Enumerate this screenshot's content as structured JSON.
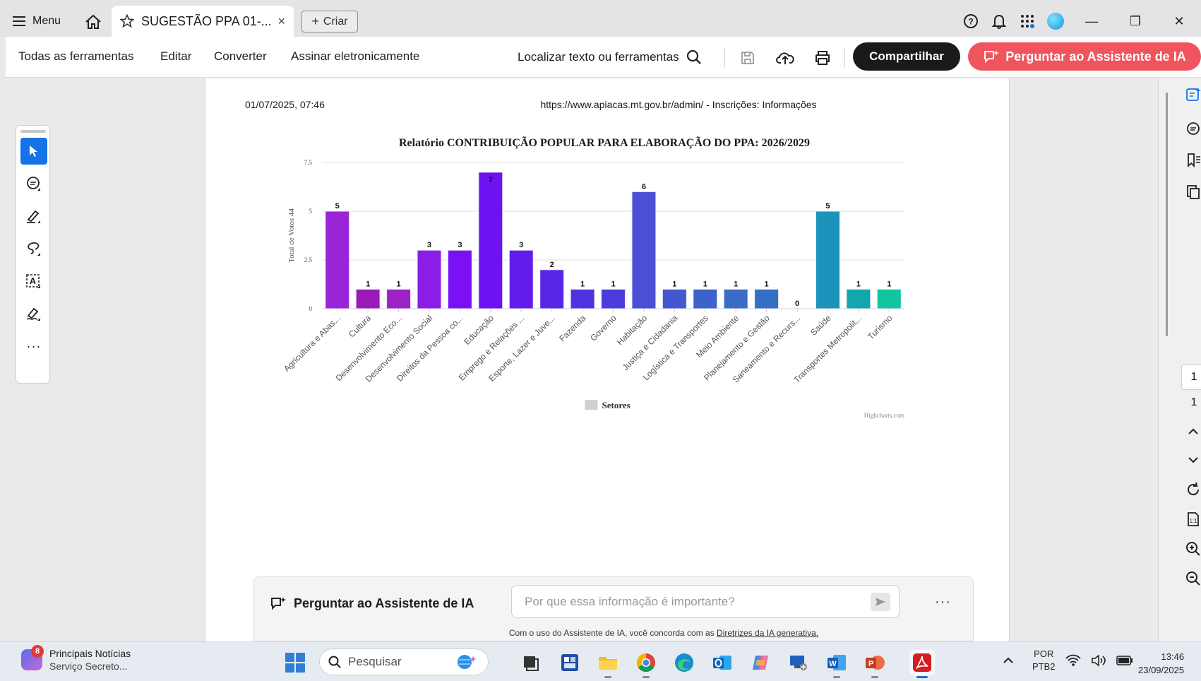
{
  "titlebar": {
    "menu_label": "Menu",
    "tab_title": "SUGESTÃO PPA 01-...",
    "tab_close": "×",
    "create_label": "Criar",
    "window_minimize": "—",
    "window_restore": "❐",
    "window_close": "✕"
  },
  "toolbar": {
    "menus": [
      "Todas as ferramentas",
      "Editar",
      "Converter",
      "Assinar eletronicamente"
    ],
    "find_label": "Localizar texto ou ferramentas",
    "share_label": "Compartilhar",
    "ai_label": "Perguntar ao Assistente de IA"
  },
  "document": {
    "date": "01/07/2025, 07:46",
    "url": "https://www.apiacas.mt.gov.br/admin/ - Inscrições: Informações"
  },
  "chart_data": {
    "type": "bar",
    "title": "Relatório CONTRIBUIÇÃO POPULAR PARA ELABORAÇÃO DO PPA: 2026/2029",
    "ylabel": "Total de Votos 44",
    "xlabel": "",
    "ylim": [
      0,
      7.5
    ],
    "yticks": [
      "0",
      "2.5",
      "5",
      "7.5"
    ],
    "legend": "Setores",
    "legend_position": "bottom-center",
    "grid": true,
    "credits": "Highcharts.com",
    "categories": [
      "Agricultura e Abas...",
      "Cultura",
      "Desenvolvimento Eco...",
      "Desenvolvimento Social",
      "Direitos da Pessoa co...",
      "Educação",
      "Emprego e Relações ...",
      "Esporte, Lazer e Juve...",
      "Fazenda",
      "Governo",
      "Habitação",
      "Justiça e Cidadania",
      "Logística e Transportes",
      "Meio Ambiente",
      "Planejamento e Gestão",
      "Saneamento e Recurs...",
      "Saúde",
      "Transportes Metropolit...",
      "Turismo"
    ],
    "values": [
      5,
      1,
      1,
      3,
      3,
      7,
      3,
      2,
      1,
      1,
      6,
      1,
      1,
      1,
      1,
      0,
      5,
      1,
      1
    ],
    "colors": [
      "#9b23d8",
      "#9b1ab8",
      "#9b22c6",
      "#8b1de6",
      "#7c10f4",
      "#6e12f1",
      "#621bea",
      "#5a26e6",
      "#5032e0",
      "#4b3cdc",
      "#4a4fd6",
      "#4357d0",
      "#3e62cb",
      "#3a6cc6",
      "#356fc4",
      "#2f7fc0",
      "#1b93ba",
      "#12a6ae",
      "#12c59e"
    ]
  },
  "ai_panel": {
    "title": "Perguntar ao Assistente de IA",
    "placeholder": "Por que essa informação é importante?",
    "more": "···",
    "terms_prefix": "Com o uso do Assistente de IA, você concorda com as ",
    "terms_link": "Diretrizes da IA generativa."
  },
  "page_nav": {
    "current": "1",
    "total": "1"
  },
  "taskbar": {
    "news_badge": "8",
    "news_title": "Principais Notícias",
    "news_subtitle": "Serviço Secreto...",
    "search_placeholder": "Pesquisar",
    "lang_top": "POR",
    "lang_bottom": "PTB2",
    "time": "13:46",
    "date": "23/09/2025"
  }
}
